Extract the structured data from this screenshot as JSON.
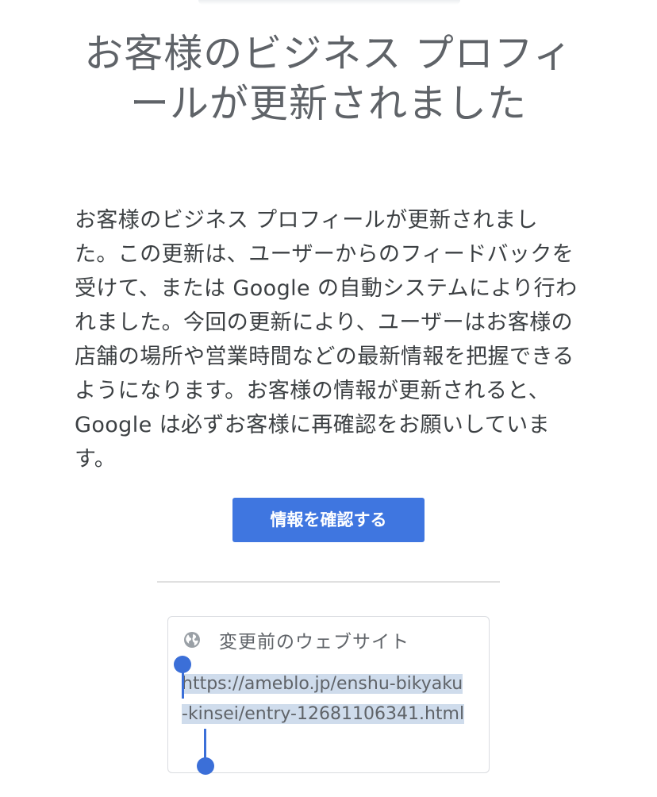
{
  "header": {
    "title": "お客様のビジネス プロフィールが更新されました"
  },
  "body": {
    "paragraph": "お客様のビジネス プロフィールが更新されました。この更新は、ユーザーからのフィードバックを受けて、または Google の自動システムにより行われました。今回の更新により、ユーザーはお客様の店舗の場所や営業時間などの最新情報を把握できるようになります。お客様の情報が更新されると、Google は必ずお客様に再確認をお願いしています。"
  },
  "actions": {
    "confirm_label": "情報を確認する"
  },
  "previous_website_card": {
    "icon": "globe-icon",
    "label": "変更前のウェブサイト",
    "url": "https://ameblo.jp/enshu-bikyaku-kinsei/entry-12681106341.html"
  },
  "colors": {
    "primary_button": "#3f76e0",
    "selection_handle": "#3b6fd8",
    "selection_highlight": "#cfdcec"
  }
}
